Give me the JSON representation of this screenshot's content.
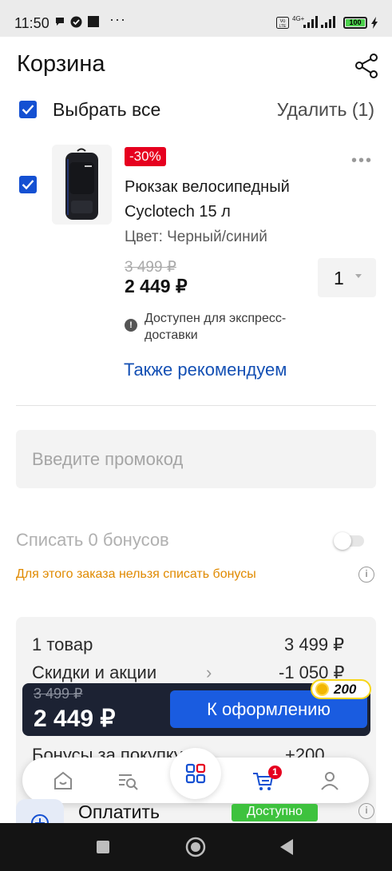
{
  "status_bar": {
    "time": "11:50",
    "dots": "···",
    "network": "4G+",
    "battery": "100"
  },
  "header": {
    "title": "Корзина",
    "share_icon": "share-icon"
  },
  "select_all": {
    "label": "Выбрать все",
    "checked": true,
    "delete_label": "Удалить (1)"
  },
  "cart_item": {
    "checked": true,
    "discount": "-30%",
    "name": "Рюкзак велосипедный Cyclotech 15 л",
    "color": "Цвет: Черный/синий",
    "old_price": "3 499 ₽",
    "price": "2 449 ₽",
    "quantity": "1",
    "availability": "Доступен для экспресс-доставки",
    "recommend_link": "Также рекомендуем"
  },
  "promo": {
    "placeholder": "Введите промокод"
  },
  "bonuses": {
    "label": "Списать 0 бонусов",
    "enabled": false,
    "warning": "Для этого заказа нельзя списать бонусы"
  },
  "summary": {
    "items_label": "1 товар",
    "items_value": "3 499 ₽",
    "discounts_label": "Скидки и акции",
    "discounts_value": "-1 050 ₽",
    "bonus_label": "Бонусы за покупку",
    "bonus_value": "+200"
  },
  "checkout": {
    "old_total": "3 499 ₽",
    "total": "2 449 ₽",
    "button_label": "К оформлению",
    "bonus_badge": "200"
  },
  "bottom_nav": {
    "items": [
      "home-icon",
      "catalog-search-icon",
      "grid-icon",
      "cart-icon",
      "profile-icon"
    ],
    "cart_count": "1"
  },
  "payment": {
    "label": "Оплатить",
    "badge": "Доступно"
  },
  "colors": {
    "accent": "#1450d2",
    "discount_red": "#e6001f",
    "warning_orange": "#e08a00",
    "checkout_dark": "#1c2233",
    "available_green": "#3ec23e"
  }
}
